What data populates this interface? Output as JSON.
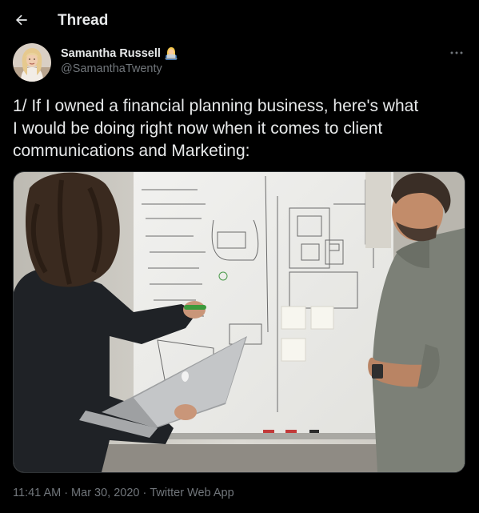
{
  "header": {
    "title": "Thread",
    "back_icon": "arrow-left-icon"
  },
  "author": {
    "name": "Samantha Russell",
    "handle": "@SamanthaTwenty",
    "emoji_icon": "woman-technologist-emoji-icon",
    "more_icon": "more-horizontal-icon"
  },
  "tweet": {
    "text_lines": [
      "1/ If I owned a financial planning business, here's what",
      "I would be doing right now when it comes to client",
      "communications and Marketing:"
    ]
  },
  "meta": {
    "time": "11:41 AM",
    "separator": "·",
    "date": "Mar 30, 2020",
    "source": "Twitter Web App"
  },
  "colors": {
    "background": "#000000",
    "text_primary": "#e7e9ea",
    "text_secondary": "#71767b",
    "border": "#2f3336"
  }
}
